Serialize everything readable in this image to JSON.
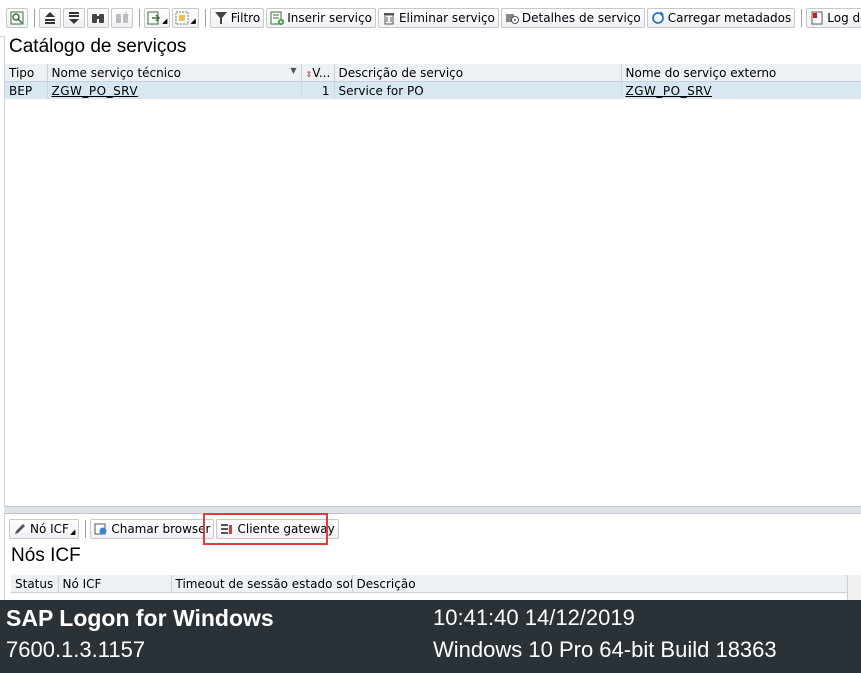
{
  "toolbar": {
    "filter_label": "Filtro",
    "insert_label": "Inserir serviço",
    "delete_label": "Eliminar serviço",
    "details_label": "Detalhes de serviço",
    "load_label": "Carregar metadados",
    "log_label": "Log de er"
  },
  "catalog": {
    "title": "Catálogo de serviços",
    "columns": [
      "Tipo",
      "Nome serviço técnico",
      "V...",
      "Descrição de serviço",
      "Nome do serviço externo"
    ],
    "rows": [
      {
        "tipo": "BEP",
        "nome_tecnico": "ZGW_PO_SRV",
        "versao": "1",
        "descricao": "Service for PO",
        "nome_externo": "ZGW_PO_SRV"
      }
    ]
  },
  "icf": {
    "toolbar": {
      "no_icf_label": "Nó ICF",
      "browser_label": "Chamar browser",
      "gateway_label": "Cliente gateway"
    },
    "title": "Nós ICF",
    "columns": [
      "Status",
      "Nó ICF",
      "Timeout de sessão estado soft",
      "Descrição"
    ]
  },
  "footer": {
    "app_name": "SAP Logon for Windows",
    "version": "7600.1.3.1157",
    "datetime": "10:41:40 14/12/2019",
    "os": "Windows 10 Pro 64-bit Build 18363"
  },
  "colors": {
    "selected_row": "#d8e8f2",
    "highlight_box": "#e23b3b",
    "footer_bg": "#2b3237"
  }
}
